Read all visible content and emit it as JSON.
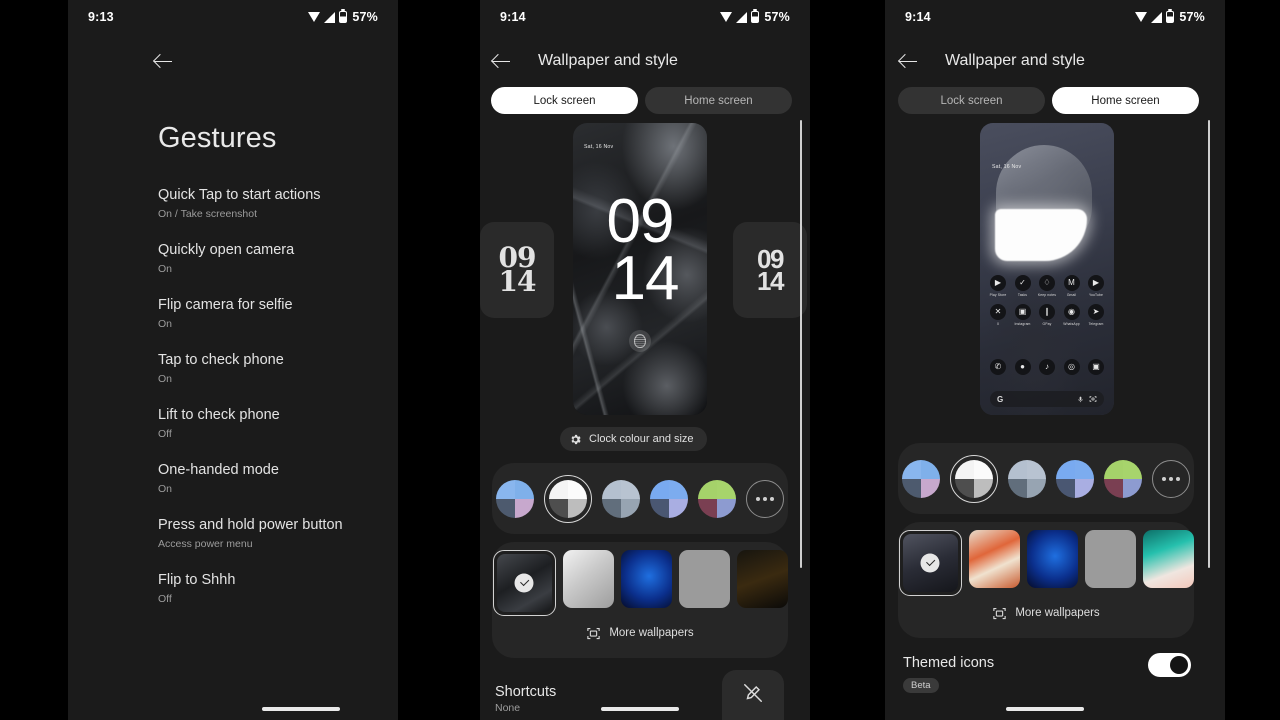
{
  "screens": {
    "gestures": {
      "status": {
        "time": "9:13",
        "battery": "57%",
        "wifi_icon": "wifi-icon",
        "signal_icon": "signal-icon",
        "battery_icon": "battery-icon"
      },
      "back_label": "back-arrow",
      "title": "Gestures",
      "items": [
        {
          "title": "Quick Tap to start actions",
          "sub": "On / Take screenshot"
        },
        {
          "title": "Quickly open camera",
          "sub": "On"
        },
        {
          "title": "Flip camera for selfie",
          "sub": "On"
        },
        {
          "title": "Tap to check phone",
          "sub": "On"
        },
        {
          "title": "Lift to check phone",
          "sub": "Off"
        },
        {
          "title": "One-handed mode",
          "sub": "On"
        },
        {
          "title": "Press and hold power button",
          "sub": "Access power menu"
        },
        {
          "title": "Flip to Shhh",
          "sub": "Off"
        }
      ]
    },
    "lock": {
      "status": {
        "time": "9:14",
        "battery": "57%"
      },
      "title": "Wallpaper and style",
      "tabs": [
        {
          "label": "Lock screen",
          "active": true
        },
        {
          "label": "Home screen",
          "active": false
        }
      ],
      "preview": {
        "date": "Sat, 16 Nov",
        "hours": "09",
        "minutes": "14"
      },
      "side_clocks": [
        {
          "hours": "09",
          "minutes": "14",
          "style": "serif"
        },
        {
          "hours": "09",
          "minutes": "14",
          "style": "bold"
        }
      ],
      "clock_chip": {
        "label": "Clock colour and size",
        "icon": "gear-icon"
      },
      "colors": [
        {
          "name": "blue-lilac",
          "q1": "#89b6ee",
          "q2": "#7fb0ea",
          "q3": "#4d5a6e",
          "q4": "#c7a8cd",
          "selected": false
        },
        {
          "name": "monochrome",
          "q1": "#f4f4f4",
          "q2": "#fbfbfb",
          "q3": "#4e4e4e",
          "q4": "#bdbdbd",
          "selected": true
        },
        {
          "name": "slate",
          "q1": "#b4c0cf",
          "q2": "#b8c3d1",
          "q3": "#616e7c",
          "q4": "#97a4b2",
          "selected": false
        },
        {
          "name": "royal-blue",
          "q1": "#79aaf0",
          "q2": "#7cacef",
          "q3": "#4a5772",
          "q4": "#a9aee2",
          "selected": false
        },
        {
          "name": "green-plum",
          "q1": "#a5d26a",
          "q2": "#a7d46c",
          "q3": "#7a3f52",
          "q4": "#8d9bd0",
          "selected": false
        }
      ],
      "more_colors_icon": "more-dots-icon",
      "wallpapers": [
        {
          "name": "dark-mech",
          "selected": true
        },
        {
          "name": "white-tube"
        },
        {
          "name": "blue-swirl"
        },
        {
          "name": "doodle-pattern"
        },
        {
          "name": "amber-night"
        }
      ],
      "more_wallpapers": {
        "label": "More wallpapers",
        "icon": "image-icon"
      },
      "shortcuts": {
        "title": "Shortcuts",
        "value": "None",
        "button_icon": "pen-off-icon"
      }
    },
    "home": {
      "status": {
        "time": "9:14",
        "battery": "57%"
      },
      "title": "Wallpaper and style",
      "tabs": [
        {
          "label": "Lock screen",
          "active": false
        },
        {
          "label": "Home screen",
          "active": true
        }
      ],
      "preview": {
        "date": "Sat, 16 Nov",
        "apps_row1": [
          {
            "label": "Play Store",
            "glyph": "▶"
          },
          {
            "label": "Tasks",
            "glyph": "✓"
          },
          {
            "label": "Keep notes",
            "glyph": "♢"
          },
          {
            "label": "Gmail",
            "glyph": "M"
          },
          {
            "label": "YouTube",
            "glyph": "▶"
          }
        ],
        "apps_row2": [
          {
            "label": "X",
            "glyph": "✕"
          },
          {
            "label": "Instagram",
            "glyph": "▣"
          },
          {
            "label": "GPay",
            "glyph": "∥"
          },
          {
            "label": "WhatsApp",
            "glyph": "◉"
          },
          {
            "label": "Telegram",
            "glyph": "➤"
          }
        ],
        "dock": [
          {
            "label": "Phone",
            "glyph": "✆"
          },
          {
            "label": "Messages",
            "glyph": "●"
          },
          {
            "label": "Music",
            "glyph": "♪"
          },
          {
            "label": "Chrome",
            "glyph": "◎"
          },
          {
            "label": "Camera",
            "glyph": "▣"
          }
        ],
        "search": {
          "logo": "G",
          "mic_icon": "mic-icon",
          "lens_icon": "lens-icon"
        }
      },
      "colors": [
        {
          "name": "blue-lilac",
          "q1": "#89b6ee",
          "q2": "#7fb0ea",
          "q3": "#4d5a6e",
          "q4": "#c7a8cd",
          "selected": false
        },
        {
          "name": "monochrome",
          "q1": "#f4f4f4",
          "q2": "#fbfbfb",
          "q3": "#4e4e4e",
          "q4": "#bdbdbd",
          "selected": true
        },
        {
          "name": "slate",
          "q1": "#b4c0cf",
          "q2": "#b8c3d1",
          "q3": "#616e7c",
          "q4": "#97a4b2",
          "selected": false
        },
        {
          "name": "royal-blue",
          "q1": "#79aaf0",
          "q2": "#7cacef",
          "q3": "#4a5772",
          "q4": "#a9aee2",
          "selected": false
        },
        {
          "name": "green-plum",
          "q1": "#a5d26a",
          "q2": "#a7d46c",
          "q3": "#7a3f52",
          "q4": "#8d9bd0",
          "selected": false
        }
      ],
      "more_colors_icon": "more-dots-icon",
      "wallpapers": [
        {
          "name": "helmet-dark",
          "selected": true
        },
        {
          "name": "orange-petals"
        },
        {
          "name": "blue-swirl"
        },
        {
          "name": "doodle-pattern"
        },
        {
          "name": "teal-gradient"
        }
      ],
      "more_wallpapers": {
        "label": "More wallpapers",
        "icon": "image-icon"
      },
      "themed_icons": {
        "label": "Themed icons",
        "badge": "Beta",
        "enabled": true
      }
    }
  }
}
